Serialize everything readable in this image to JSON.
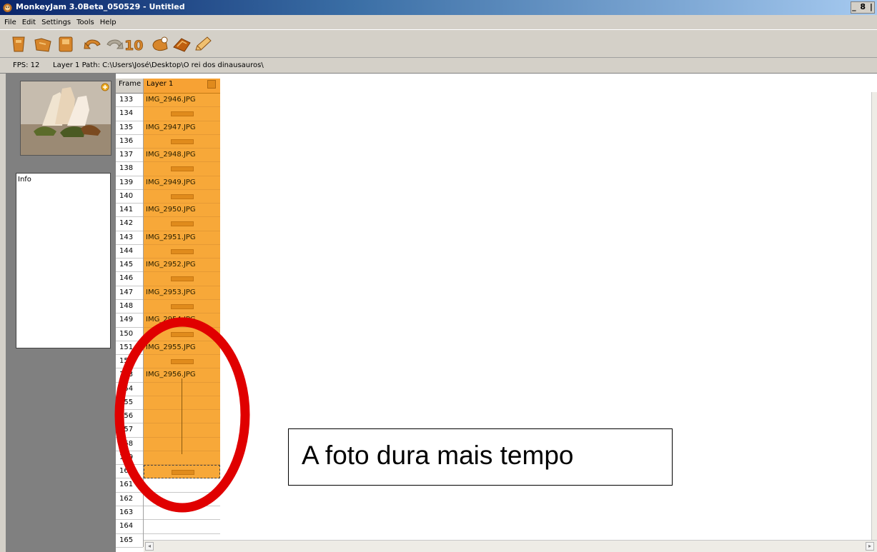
{
  "window": {
    "title": "MonkeyJam 3.0Beta_050529 - Untitled",
    "controls_label": "_ 8 |"
  },
  "menu": [
    "File",
    "Edit",
    "Settings",
    "Tools",
    "Help"
  ],
  "toolbar_icons": [
    "new-scene-icon",
    "open-icon",
    "save-icon",
    "undo-icon",
    "redo-icon",
    "ten-frames-icon",
    "capture-icon",
    "import-icon",
    "edit-icon"
  ],
  "status": {
    "fps": "FPS: 12",
    "path": "Layer 1 Path: C:\\Users\\José\\Desktop\\O rei dos dinausauros\\"
  },
  "left_panel": {
    "info_label": "Info"
  },
  "timesheet": {
    "frame_header": "Frame",
    "layer_header": "Layer 1",
    "frames": [
      "133",
      "134",
      "135",
      "136",
      "137",
      "138",
      "139",
      "140",
      "141",
      "142",
      "143",
      "144",
      "145",
      "146",
      "147",
      "148",
      "149",
      "150",
      "151",
      "152",
      "153",
      "154",
      "155",
      "156",
      "157",
      "158",
      "159",
      "160",
      "161",
      "162",
      "163",
      "164",
      "165"
    ],
    "cells": [
      {
        "text": "IMG_2946.JPG"
      },
      {
        "text": "",
        "bar": true
      },
      {
        "text": "IMG_2947.JPG"
      },
      {
        "text": "",
        "bar": true
      },
      {
        "text": "IMG_2948.JPG"
      },
      {
        "text": "",
        "bar": true
      },
      {
        "text": "IMG_2949.JPG"
      },
      {
        "text": "",
        "bar": true
      },
      {
        "text": "IMG_2950.JPG"
      },
      {
        "text": "",
        "bar": true
      },
      {
        "text": "IMG_2951.JPG"
      },
      {
        "text": "",
        "bar": true
      },
      {
        "text": "IMG_2952.JPG"
      },
      {
        "text": "",
        "bar": true
      },
      {
        "text": "IMG_2953.JPG"
      },
      {
        "text": "",
        "bar": true
      },
      {
        "text": "IMG_2954.JPG"
      },
      {
        "text": "",
        "bar": true
      },
      {
        "text": "IMG_2955.JPG"
      },
      {
        "text": "",
        "bar": true
      },
      {
        "text": "IMG_2956.JPG"
      },
      {
        "text": ""
      },
      {
        "text": ""
      },
      {
        "text": ""
      },
      {
        "text": ""
      },
      {
        "text": ""
      },
      {
        "text": ""
      },
      {
        "text": "",
        "bar": true,
        "selected": true
      }
    ]
  },
  "annotation": {
    "text": "A foto dura mais tempo"
  },
  "colors": {
    "cell_orange": "#f7a839",
    "highlight_red": "#e00000"
  }
}
